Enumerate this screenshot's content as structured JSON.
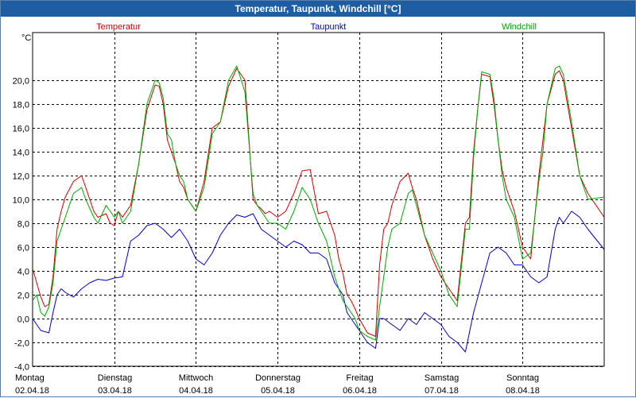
{
  "window": {
    "title": "Temperatur, Taupunkt, Windchill [°C]"
  },
  "chart_data": {
    "type": "line",
    "title": "Temperatur, Taupunkt, Windchill [°C]",
    "ylabel": "°C",
    "ylim": [
      -4,
      24
    ],
    "yticks": [
      -4,
      -2,
      0,
      2,
      4,
      6,
      8,
      10,
      12,
      14,
      16,
      18,
      20
    ],
    "ytick_labels": [
      "-4,0",
      "-2,0",
      "0,0",
      "2,0",
      "4,0",
      "6,0",
      "8,0",
      "10,0",
      "12,0",
      "14,0",
      "16,0",
      "18,0",
      "20,0"
    ],
    "xlim": [
      0,
      7
    ],
    "x_unit": "days since 02.04.18 00:00",
    "day_labels": [
      {
        "weekday": "Montag",
        "date": "02.04.18"
      },
      {
        "weekday": "Dienstag",
        "date": "03.04.18"
      },
      {
        "weekday": "Mittwoch",
        "date": "04.04.18"
      },
      {
        "weekday": "Donnerstag",
        "date": "05.04.18"
      },
      {
        "weekday": "Freitag",
        "date": "06.04.18"
      },
      {
        "weekday": "Samstag",
        "date": "07.04.18"
      },
      {
        "weekday": "Sonntag",
        "date": "08.04.18"
      }
    ],
    "grid": true,
    "legend_placement": "top",
    "series": [
      {
        "name": "Temperatur",
        "color": "#d00000",
        "x": [
          0,
          0.1,
          0.15,
          0.2,
          0.25,
          0.3,
          0.35,
          0.4,
          0.5,
          0.6,
          0.65,
          0.75,
          0.8,
          0.9,
          0.95,
          1.0,
          1.05,
          1.1,
          1.2,
          1.3,
          1.4,
          1.5,
          1.55,
          1.6,
          1.65,
          1.7,
          1.75,
          1.8,
          1.85,
          1.9,
          2.0,
          2.1,
          2.2,
          2.3,
          2.4,
          2.5,
          2.6,
          2.7,
          2.75,
          2.8,
          2.85,
          2.9,
          3.0,
          3.1,
          3.2,
          3.3,
          3.4,
          3.5,
          3.6,
          3.7,
          3.75,
          3.8,
          3.85,
          3.9,
          3.95,
          4.0,
          4.1,
          4.2,
          4.25,
          4.3,
          4.35,
          4.4,
          4.5,
          4.6,
          4.65,
          4.7,
          4.8,
          4.9,
          5.0,
          5.1,
          5.2,
          5.3,
          5.35,
          5.4,
          5.45,
          5.5,
          5.6,
          5.65,
          5.7,
          5.75,
          5.8,
          5.9,
          6.0,
          6.1,
          6.2,
          6.25,
          6.3,
          6.4,
          6.45,
          6.5,
          6.6,
          6.7,
          6.8,
          7.0
        ],
        "y": [
          4.2,
          1.8,
          1.0,
          1.2,
          3.5,
          7.5,
          9.0,
          10.2,
          11.5,
          12.0,
          11.0,
          9.0,
          8.5,
          8.8,
          8.0,
          7.8,
          9.0,
          8.5,
          9.5,
          13.0,
          17.5,
          19.6,
          19.5,
          18.0,
          15.0,
          14.0,
          13.0,
          11.5,
          11.0,
          10.0,
          9.0,
          11.5,
          16.0,
          16.5,
          19.5,
          21.0,
          20.0,
          10.0,
          9.5,
          9.2,
          8.8,
          9.0,
          8.5,
          9.0,
          10.5,
          12.4,
          12.5,
          8.8,
          9.0,
          7.0,
          5.0,
          3.8,
          2.0,
          1.5,
          0.8,
          0.0,
          -1.2,
          -1.5,
          4.5,
          7.5,
          8.0,
          9.5,
          11.5,
          12.2,
          11.0,
          10.0,
          7.0,
          5.0,
          3.5,
          2.5,
          1.5,
          8.0,
          8.5,
          14.0,
          17.5,
          20.5,
          20.3,
          18.0,
          15.0,
          12.5,
          11.0,
          9.0,
          6.0,
          5.0,
          12.0,
          15.0,
          18.0,
          20.5,
          20.8,
          20.0,
          16.0,
          12.0,
          10.5,
          8.5
        ]
      },
      {
        "name": "Taupunkt",
        "color": "#0000cc",
        "x": [
          0,
          0.1,
          0.2,
          0.25,
          0.3,
          0.35,
          0.4,
          0.5,
          0.6,
          0.7,
          0.8,
          0.9,
          1.0,
          1.1,
          1.2,
          1.3,
          1.4,
          1.5,
          1.6,
          1.7,
          1.8,
          1.9,
          2.0,
          2.1,
          2.2,
          2.3,
          2.4,
          2.5,
          2.6,
          2.7,
          2.8,
          2.9,
          3.0,
          3.1,
          3.2,
          3.3,
          3.4,
          3.5,
          3.6,
          3.7,
          3.75,
          3.8,
          3.85,
          3.9,
          4.0,
          4.1,
          4.2,
          4.25,
          4.3,
          4.4,
          4.5,
          4.6,
          4.7,
          4.8,
          4.9,
          5.0,
          5.1,
          5.2,
          5.3,
          5.4,
          5.5,
          5.6,
          5.7,
          5.8,
          5.9,
          6.0,
          6.1,
          6.2,
          6.3,
          6.4,
          6.45,
          6.5,
          6.6,
          6.7,
          6.8,
          7.0
        ],
        "y": [
          0.0,
          -1.0,
          -1.2,
          0.5,
          2.0,
          2.5,
          2.2,
          1.8,
          2.5,
          3.0,
          3.3,
          3.2,
          3.4,
          3.5,
          6.5,
          7.0,
          7.8,
          8.0,
          7.5,
          6.8,
          7.5,
          6.5,
          5.0,
          4.5,
          5.5,
          7.0,
          8.0,
          8.7,
          8.5,
          8.8,
          7.5,
          7.0,
          6.5,
          6.0,
          6.5,
          6.2,
          5.5,
          5.5,
          5.0,
          3.0,
          2.5,
          2.0,
          0.5,
          0.0,
          -1.0,
          -2.0,
          -2.5,
          0.0,
          0.0,
          -0.5,
          -1.0,
          0.0,
          -0.5,
          0.5,
          0.0,
          -0.5,
          -1.5,
          -2.0,
          -2.8,
          0.5,
          3.0,
          5.5,
          6.0,
          5.5,
          4.5,
          4.5,
          3.5,
          3.0,
          3.5,
          7.5,
          8.5,
          8.0,
          9.0,
          8.5,
          7.5,
          5.8
        ]
      },
      {
        "name": "Windchill",
        "color": "#00aa00",
        "x": [
          0,
          0.05,
          0.1,
          0.15,
          0.2,
          0.25,
          0.3,
          0.35,
          0.4,
          0.5,
          0.6,
          0.65,
          0.75,
          0.8,
          0.9,
          0.95,
          1.0,
          1.05,
          1.1,
          1.2,
          1.3,
          1.4,
          1.5,
          1.55,
          1.6,
          1.65,
          1.7,
          1.75,
          1.8,
          1.85,
          1.9,
          2.0,
          2.1,
          2.2,
          2.3,
          2.4,
          2.5,
          2.6,
          2.7,
          2.75,
          2.8,
          2.85,
          2.9,
          3.0,
          3.1,
          3.2,
          3.3,
          3.4,
          3.5,
          3.6,
          3.65,
          3.7,
          3.75,
          3.8,
          3.85,
          3.9,
          3.95,
          4.0,
          4.1,
          4.2,
          4.25,
          4.3,
          4.35,
          4.4,
          4.5,
          4.6,
          4.65,
          4.7,
          4.8,
          4.9,
          5.0,
          5.1,
          5.2,
          5.3,
          5.35,
          5.4,
          5.45,
          5.5,
          5.6,
          5.65,
          5.7,
          5.75,
          5.8,
          5.9,
          6.0,
          6.1,
          6.2,
          6.25,
          6.3,
          6.4,
          6.45,
          6.5,
          6.6,
          6.7,
          6.8,
          7.0
        ],
        "y": [
          1.5,
          2.0,
          0.5,
          0.2,
          1.0,
          3.0,
          6.5,
          7.5,
          8.5,
          10.5,
          11.0,
          10.0,
          8.5,
          8.0,
          9.5,
          9.0,
          8.5,
          9.0,
          8.0,
          9.0,
          13.0,
          18.0,
          20.0,
          19.8,
          18.5,
          15.5,
          15.0,
          13.0,
          12.0,
          11.5,
          10.0,
          9.0,
          11.0,
          15.5,
          16.5,
          20.0,
          21.2,
          19.0,
          10.5,
          9.5,
          9.0,
          8.5,
          8.0,
          8.0,
          7.5,
          9.0,
          11.0,
          10.0,
          8.0,
          6.5,
          5.0,
          3.5,
          2.5,
          1.5,
          1.0,
          0.5,
          0.0,
          -1.0,
          -1.5,
          -1.8,
          1.0,
          3.5,
          6.0,
          7.5,
          8.0,
          10.5,
          10.8,
          9.5,
          7.0,
          5.5,
          4.0,
          2.0,
          1.0,
          7.5,
          7.5,
          13.5,
          17.5,
          20.7,
          20.5,
          18.5,
          15.0,
          12.0,
          10.0,
          8.5,
          5.0,
          5.5,
          11.5,
          14.0,
          18.0,
          21.0,
          21.2,
          20.5,
          16.5,
          12.0,
          10.0,
          10.2
        ]
      }
    ]
  }
}
